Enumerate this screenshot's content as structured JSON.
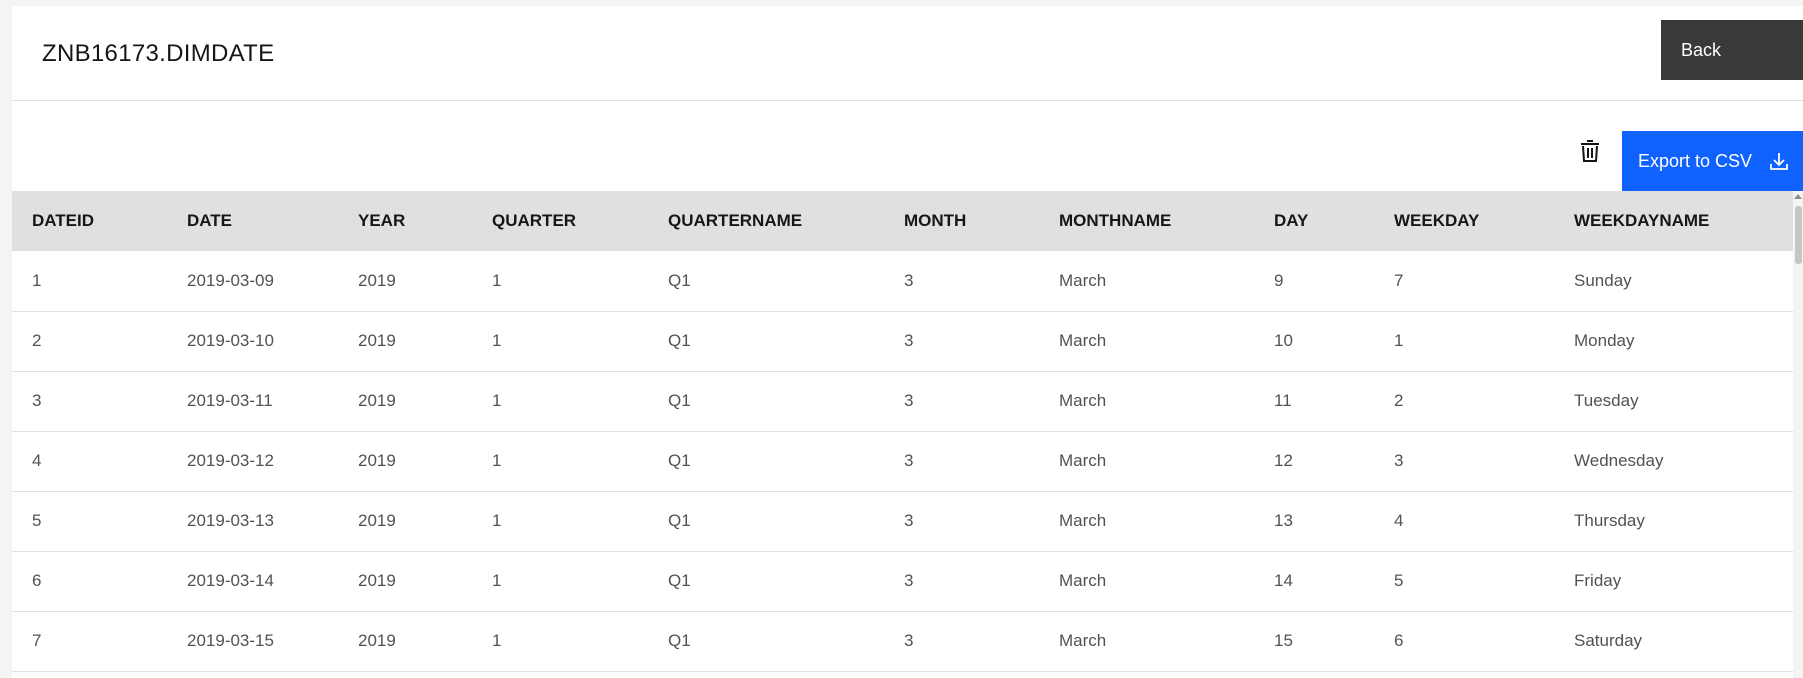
{
  "header": {
    "title": "ZNB16173.DIMDATE",
    "back_label": "Back"
  },
  "toolbar": {
    "delete_icon": "trash-icon",
    "export_label": "Export to CSV",
    "export_icon": "download-icon",
    "colors": {
      "export_bg": "#0f62fe",
      "back_bg": "#393939"
    }
  },
  "table": {
    "columns": [
      "DATEID",
      "DATE",
      "YEAR",
      "QUARTER",
      "QUARTERNAME",
      "MONTH",
      "MONTHNAME",
      "DAY",
      "WEEKDAY",
      "WEEKDAYNAME"
    ],
    "rows": [
      [
        "1",
        "2019-03-09",
        "2019",
        "1",
        "Q1",
        "3",
        "March",
        "9",
        "7",
        "Sunday"
      ],
      [
        "2",
        "2019-03-10",
        "2019",
        "1",
        "Q1",
        "3",
        "March",
        "10",
        "1",
        "Monday"
      ],
      [
        "3",
        "2019-03-11",
        "2019",
        "1",
        "Q1",
        "3",
        "March",
        "11",
        "2",
        "Tuesday"
      ],
      [
        "4",
        "2019-03-12",
        "2019",
        "1",
        "Q1",
        "3",
        "March",
        "12",
        "3",
        "Wednesday"
      ],
      [
        "5",
        "2019-03-13",
        "2019",
        "1",
        "Q1",
        "3",
        "March",
        "13",
        "4",
        "Thursday"
      ],
      [
        "6",
        "2019-03-14",
        "2019",
        "1",
        "Q1",
        "3",
        "March",
        "14",
        "5",
        "Friday"
      ],
      [
        "7",
        "2019-03-15",
        "2019",
        "1",
        "Q1",
        "3",
        "March",
        "15",
        "6",
        "Saturday"
      ]
    ]
  }
}
